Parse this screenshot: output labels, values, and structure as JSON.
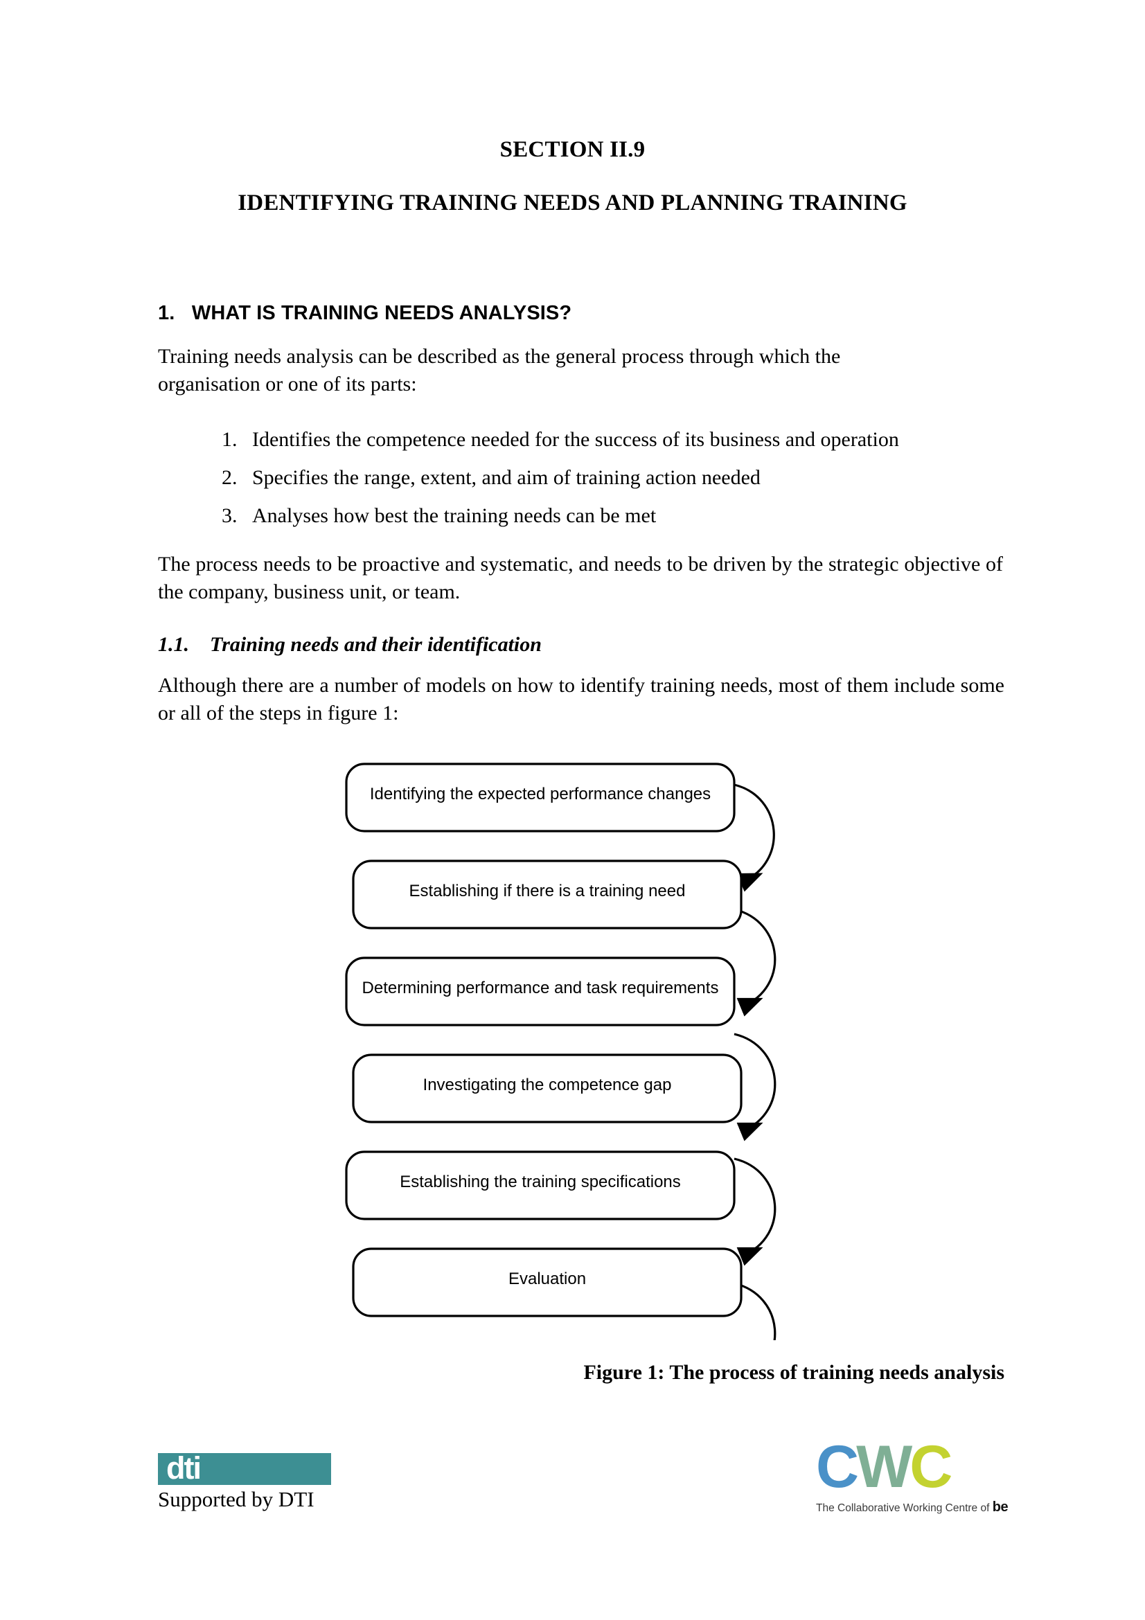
{
  "document": {
    "section_label": "SECTION II.9",
    "main_title": "IDENTIFYING TRAINING NEEDS AND PLANNING TRAINING"
  },
  "sections": {
    "heading_1": "1.   WHAT IS TRAINING NEEDS ANALYSIS?",
    "para_intro": "Training needs analysis can be described as the general process through which the organisation or one of its parts:",
    "numbered_list": [
      {
        "number": "1.",
        "text": "Identifies the competence needed for the success of its business and operation"
      },
      {
        "number": "2.",
        "text": "Specifies the range, extent, and aim of training action needed"
      },
      {
        "number": "3.",
        "text": "Analyses how best the training needs can be met"
      }
    ],
    "para_process": "The process needs to be proactive and systematic, and needs to be driven by the strategic objective of the company, business unit, or team.",
    "heading_1_1": "1.1.    Training needs and their identification",
    "para_models": "Although there are a number of models on how to identify training needs, most of them include some or all of the steps in figure 1:"
  },
  "figure": {
    "caption": "Figure 1: The process of training needs analysis",
    "steps": [
      "Identifying the expected performance changes",
      "Establishing if there is a training need",
      "Determining performance and task requirements",
      "Investigating the competence gap",
      "Establishing the training specifications",
      "Evaluation"
    ]
  },
  "footer": {
    "dti": {
      "wordmark": "dti",
      "caption": "Supported by DTI",
      "brand_color": "#3d8f93"
    },
    "cwc": {
      "letter_c1": "C",
      "letter_w": "W",
      "letter_c2": "C",
      "tagline": "The Collaborative Working Centre of",
      "be": "be",
      "color_c1": "#4a91c8",
      "color_w": "#7faf95",
      "color_c2": "#c3d230"
    }
  }
}
